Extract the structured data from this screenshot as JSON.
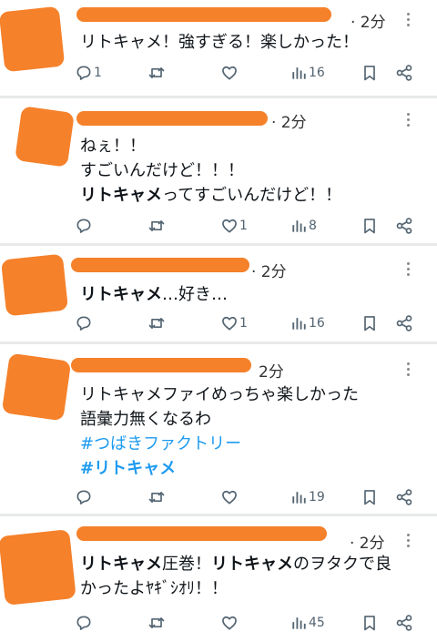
{
  "tweets": [
    {
      "time": "· 2分",
      "lines": [
        {
          "segments": [
            {
              "text": "リトキャメ！強すぎる！楽しかった！",
              "style": "normal"
            }
          ]
        }
      ],
      "replies": "1",
      "retweets": "",
      "likes": "",
      "views": "16"
    },
    {
      "time": "· 2分",
      "lines": [
        {
          "segments": [
            {
              "text": "ねぇ！！",
              "style": "normal"
            }
          ]
        },
        {
          "segments": [
            {
              "text": "すごいんだけど！！！",
              "style": "normal"
            }
          ]
        },
        {
          "segments": [
            {
              "text": "リトキャメ",
              "style": "bold"
            },
            {
              "text": "ってすごいんだけど！！",
              "style": "normal"
            }
          ]
        }
      ],
      "replies": "",
      "retweets": "",
      "likes": "1",
      "views": "8"
    },
    {
      "time": "· 2分",
      "lines": [
        {
          "segments": [
            {
              "text": "リトキャメ",
              "style": "bold"
            },
            {
              "text": "…好き…",
              "style": "normal"
            }
          ]
        }
      ],
      "replies": "",
      "retweets": "",
      "likes": "1",
      "views": "16"
    },
    {
      "time": "2分",
      "lines": [
        {
          "segments": [
            {
              "text": "リトキャメファイめっちゃ楽しかった",
              "style": "normal"
            }
          ]
        },
        {
          "segments": [
            {
              "text": "語彙力無くなるわ",
              "style": "normal"
            }
          ]
        },
        {
          "segments": [
            {
              "text": "#つばきファクトリー",
              "style": "hashtag"
            }
          ]
        },
        {
          "segments": [
            {
              "text": "#リトキャメ",
              "style": "hashtag-bold"
            }
          ]
        }
      ],
      "replies": "",
      "retweets": "",
      "likes": "",
      "views": "19"
    },
    {
      "time": "· 2分",
      "lines": [
        {
          "segments": [
            {
              "text": "リトキャメ",
              "style": "bold"
            },
            {
              "text": "圧巻！",
              "style": "normal"
            },
            {
              "text": "リトキャメ",
              "style": "bold"
            },
            {
              "text": "のヲタクで良",
              "style": "normal"
            }
          ]
        },
        {
          "segments": [
            {
              "text": "かったよﾔｷﾞｼｵﾘ！！",
              "style": "normal"
            }
          ]
        }
      ],
      "replies": "",
      "retweets": "",
      "likes": "",
      "views": "45"
    }
  ],
  "icons": {
    "reply": "reply-icon",
    "retweet": "retweet-icon",
    "like": "heart-icon",
    "views": "views-icon",
    "bookmark": "bookmark-icon",
    "share": "share-icon",
    "more": "more-icon"
  },
  "colors": {
    "redaction": "#f5812b",
    "hashtag": "#1d9bf0",
    "text": "#0f1419",
    "icon": "#536471"
  }
}
